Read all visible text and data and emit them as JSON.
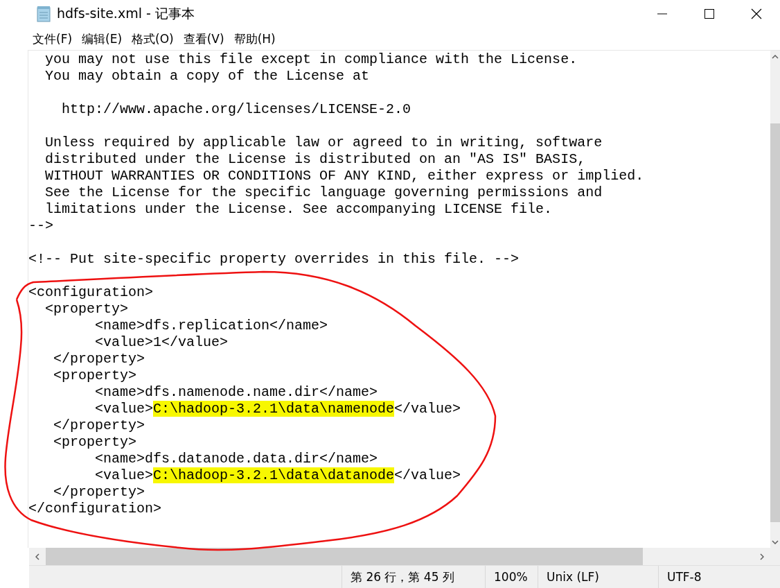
{
  "window": {
    "title": "hdfs-site.xml - 记事本"
  },
  "menu": [
    {
      "label": "文件(F)"
    },
    {
      "label": "编辑(E)"
    },
    {
      "label": "格式(O)"
    },
    {
      "label": "查看(V)"
    },
    {
      "label": "帮助(H)"
    }
  ],
  "editor": {
    "lines": [
      {
        "kind": "text",
        "text": "  you may not use this file except in compliance with the License."
      },
      {
        "kind": "text",
        "text": "  You may obtain a copy of the License at"
      },
      {
        "kind": "blank"
      },
      {
        "kind": "text",
        "text": "    http://www.apache.org/licenses/LICENSE-2.0"
      },
      {
        "kind": "blank"
      },
      {
        "kind": "text",
        "text": "  Unless required by applicable law or agreed to in writing, software"
      },
      {
        "kind": "text",
        "text": "  distributed under the License is distributed on an \"AS IS\" BASIS,"
      },
      {
        "kind": "text",
        "text": "  WITHOUT WARRANTIES OR CONDITIONS OF ANY KIND, either express or implied."
      },
      {
        "kind": "text",
        "text": "  See the License for the specific language governing permissions and"
      },
      {
        "kind": "text",
        "text": "  limitations under the License. See accompanying LICENSE file."
      },
      {
        "kind": "text",
        "text": "-->"
      },
      {
        "kind": "blank"
      },
      {
        "kind": "text",
        "text": "<!-- Put site-specific property overrides in this file. -->"
      },
      {
        "kind": "blank"
      },
      {
        "kind": "text",
        "text": "<configuration>"
      },
      {
        "kind": "text",
        "text": "  <property>"
      },
      {
        "kind": "text",
        "text": "        <name>dfs.replication</name>"
      },
      {
        "kind": "text",
        "text": "        <value>1</value>"
      },
      {
        "kind": "text",
        "text": "   </property>"
      },
      {
        "kind": "text",
        "text": "   <property>"
      },
      {
        "kind": "text",
        "text": "        <name>dfs.namenode.name.dir</name>"
      },
      {
        "kind": "marked",
        "segments": [
          {
            "text": "        <value>",
            "highlighted": false
          },
          {
            "text": "C:\\hadoop-3.2.1\\data\\namenode",
            "highlighted": true
          },
          {
            "text": "</value>",
            "highlighted": false
          }
        ]
      },
      {
        "kind": "text",
        "text": "   </property>"
      },
      {
        "kind": "text",
        "text": "   <property>"
      },
      {
        "kind": "text",
        "text": "        <name>dfs.datanode.data.dir</name>"
      },
      {
        "kind": "marked",
        "segments": [
          {
            "text": "        <value>",
            "highlighted": false
          },
          {
            "text": "C:\\hadoop-3.2.1\\data\\datanode",
            "highlighted": true
          },
          {
            "text": "</value>",
            "highlighted": false
          }
        ]
      },
      {
        "kind": "text",
        "text": "   </property>"
      },
      {
        "kind": "text",
        "text": "</configuration>"
      }
    ]
  },
  "annotation": {
    "kind": "loop",
    "color": "#ee1111"
  },
  "status_bar": [
    {
      "text": "第 26 行，第 45 列"
    },
    {
      "text": "100%"
    },
    {
      "text": "Unix (LF)"
    },
    {
      "text": "UTF-8"
    }
  ]
}
